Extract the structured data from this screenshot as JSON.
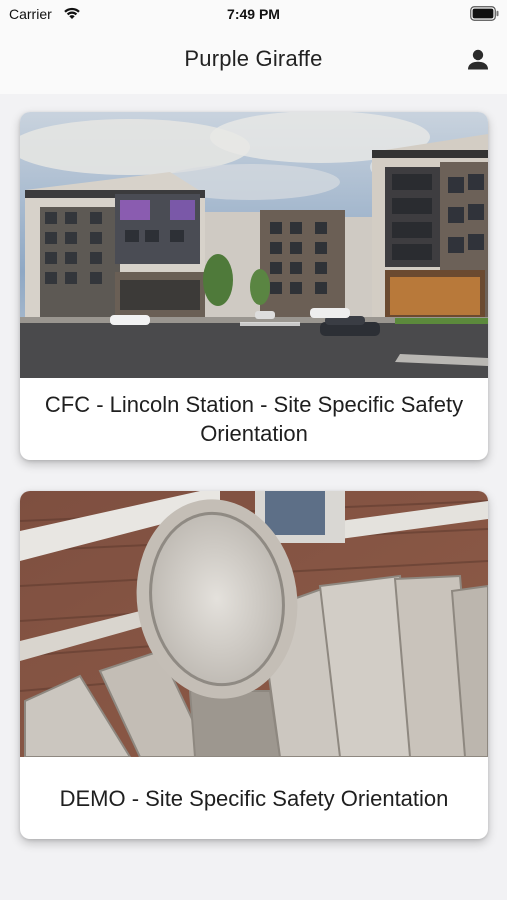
{
  "status_bar": {
    "carrier": "Carrier",
    "time": "7:49 PM",
    "icons": [
      "wifi-icon",
      "battery-icon"
    ]
  },
  "nav": {
    "title": "Purple Giraffe",
    "profile_icon": "person-icon"
  },
  "cards": [
    {
      "title": "CFC - Lincoln Station - Site Specific Safety Orientation",
      "image": "apartment-building-rendering"
    },
    {
      "title": "DEMO - Site Specific Safety Orientation",
      "image": "stone-facade-ornament-photo"
    }
  ],
  "colors": {
    "background": "#f2f2f4",
    "bar_background": "#fafafa",
    "card_background": "#ffffff",
    "text": "#1f1f1f"
  }
}
